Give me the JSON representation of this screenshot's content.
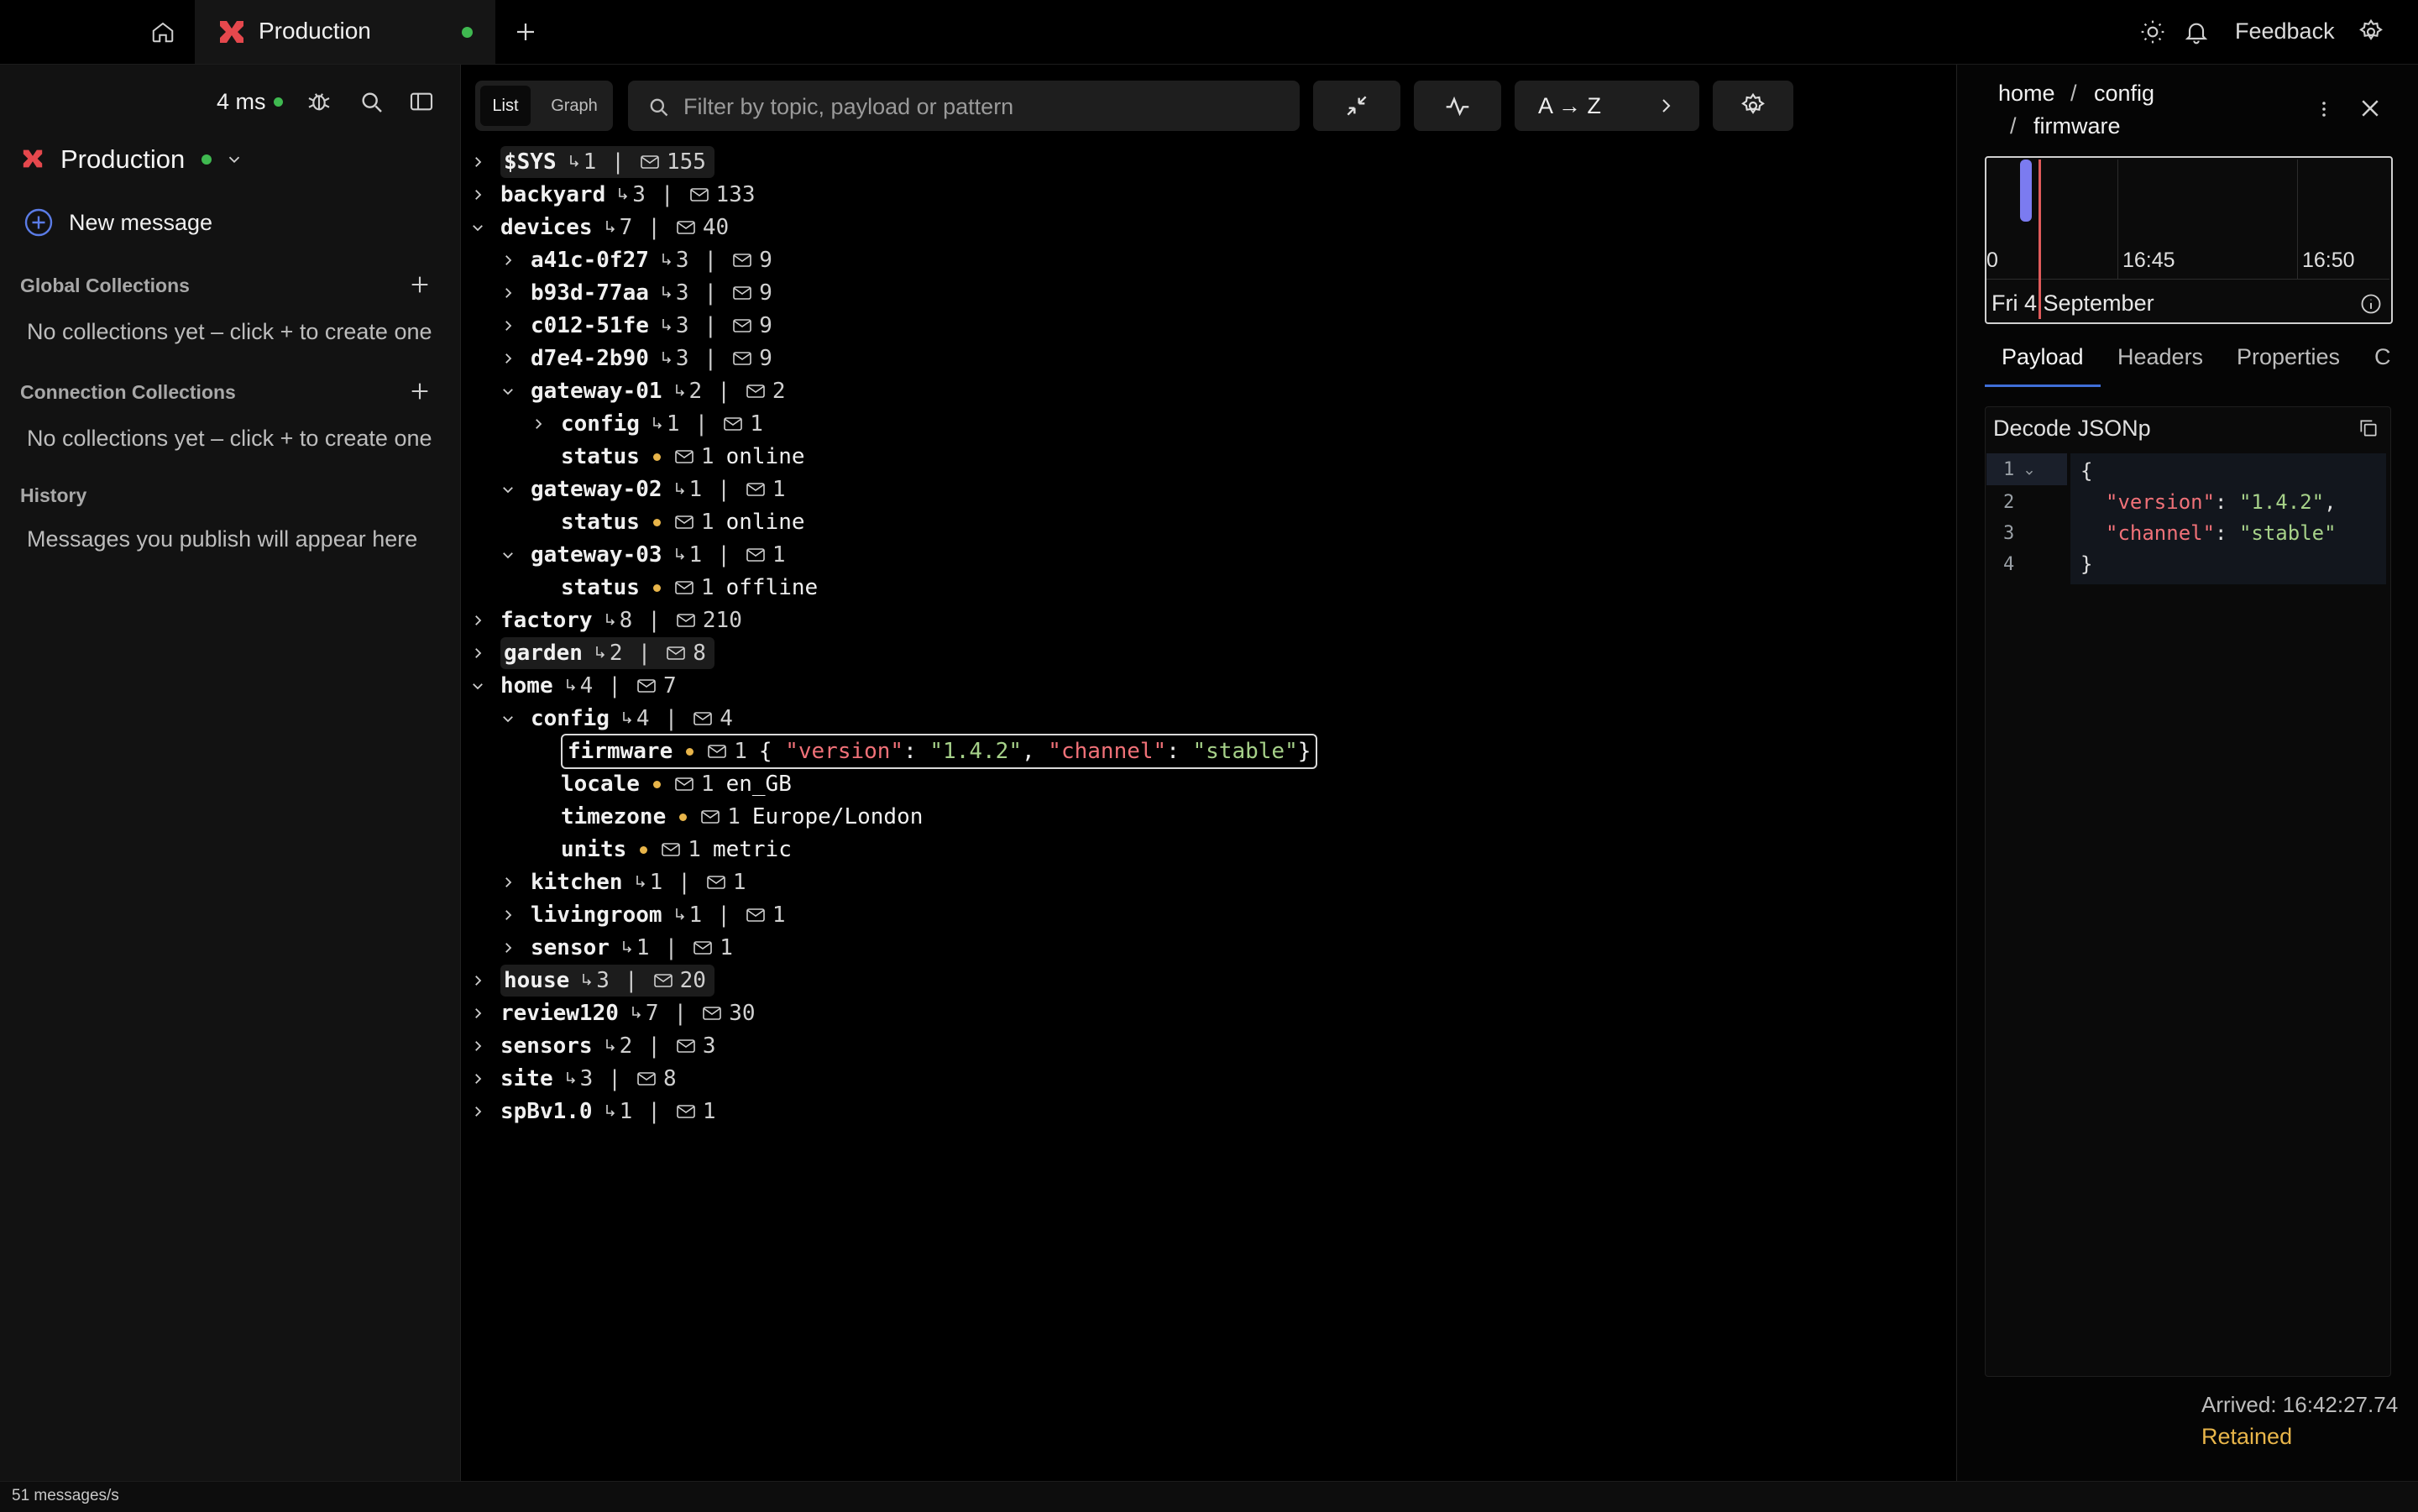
{
  "titlebar": {
    "tab_label": "Production",
    "feedback_label": "Feedback"
  },
  "sidebar": {
    "latency": "4 ms",
    "connection_name": "Production",
    "new_message_label": "New message",
    "global_collections_title": "Global Collections",
    "global_collections_empty": "No collections yet – click + to create one",
    "connection_collections_title": "Connection Collections",
    "connection_collections_empty": "No collections yet – click + to create one",
    "history_title": "History",
    "history_empty": "Messages you publish will appear here"
  },
  "toolbar": {
    "view_list": "List",
    "view_graph": "Graph",
    "filter_placeholder": "Filter by topic, payload or pattern",
    "sort_label": "A → Z"
  },
  "tree": {
    "sys": {
      "name": "$SYS",
      "subtopics": "1",
      "messages": "155"
    },
    "backyard": {
      "name": "backyard",
      "subtopics": "3",
      "messages": "133"
    },
    "devices": {
      "name": "devices",
      "subtopics": "7",
      "messages": "40"
    },
    "a41c": {
      "name": "a41c-0f27",
      "subtopics": "3",
      "messages": "9"
    },
    "b93d": {
      "name": "b93d-77aa",
      "subtopics": "3",
      "messages": "9"
    },
    "c012": {
      "name": "c012-51fe",
      "subtopics": "3",
      "messages": "9"
    },
    "d7e4": {
      "name": "d7e4-2b90",
      "subtopics": "3",
      "messages": "9"
    },
    "gw01": {
      "name": "gateway-01",
      "subtopics": "2",
      "messages": "2"
    },
    "gw01_config": {
      "name": "config",
      "subtopics": "1",
      "messages": "1"
    },
    "gw01_status": {
      "name": "status",
      "messages": "1",
      "value": "online"
    },
    "gw02": {
      "name": "gateway-02",
      "subtopics": "1",
      "messages": "1"
    },
    "gw02_status": {
      "name": "status",
      "messages": "1",
      "value": "online"
    },
    "gw03": {
      "name": "gateway-03",
      "subtopics": "1",
      "messages": "1"
    },
    "gw03_status": {
      "name": "status",
      "messages": "1",
      "value": "offline"
    },
    "factory": {
      "name": "factory",
      "subtopics": "8",
      "messages": "210"
    },
    "garden": {
      "name": "garden",
      "subtopics": "2",
      "messages": "8"
    },
    "home": {
      "name": "home",
      "subtopics": "4",
      "messages": "7"
    },
    "home_config": {
      "name": "config",
      "subtopics": "4",
      "messages": "4"
    },
    "firmware": {
      "name": "firmware",
      "messages": "1",
      "p_open": "{ ",
      "k1": "\"version\"",
      "c1": ": ",
      "v1": "\"1.4.2\"",
      "comma": ", ",
      "k2": "\"channel\"",
      "c2": ": ",
      "v2": "\"stable\"",
      "p_close": "}"
    },
    "locale": {
      "name": "locale",
      "messages": "1",
      "value": "en_GB"
    },
    "timezone": {
      "name": "timezone",
      "messages": "1",
      "value": "Europe/London"
    },
    "units": {
      "name": "units",
      "messages": "1",
      "value": "metric"
    },
    "kitchen": {
      "name": "kitchen",
      "subtopics": "1",
      "messages": "1"
    },
    "livingroom": {
      "name": "livingroom",
      "subtopics": "1",
      "messages": "1"
    },
    "sensor": {
      "name": "sensor",
      "subtopics": "1",
      "messages": "1"
    },
    "house": {
      "name": "house",
      "subtopics": "3",
      "messages": "20"
    },
    "review120": {
      "name": "review120",
      "subtopics": "7",
      "messages": "30"
    },
    "sensors": {
      "name": "sensors",
      "subtopics": "2",
      "messages": "3"
    },
    "site": {
      "name": "site",
      "subtopics": "3",
      "messages": "8"
    },
    "spbv": {
      "name": "spBv1.0",
      "subtopics": "1",
      "messages": "1"
    }
  },
  "details": {
    "breadcrumb": [
      "home",
      "config",
      "firmware"
    ],
    "timeline": {
      "tick_0": "0",
      "tick_1": "16:45",
      "tick_2": "16:50",
      "date": "Fri 4 September"
    },
    "tabs": [
      "Payload",
      "Headers",
      "Properties",
      "C"
    ],
    "decode_label": "Decode",
    "decode_format": "JSONp",
    "code_lines": [
      {
        "n": "1",
        "parts": [
          "{"
        ]
      },
      {
        "n": "2",
        "key": "\"version\"",
        "colon": ": ",
        "val": "\"1.4.2\"",
        "end": ","
      },
      {
        "n": "3",
        "key": "\"channel\"",
        "colon": ": ",
        "val": "\"stable\""
      },
      {
        "n": "4",
        "parts": [
          "}"
        ]
      }
    ],
    "arrived": "Arrived: 16:42:27.74",
    "retained": "Retained"
  },
  "statusbar": {
    "rate": "51 messages/s"
  },
  "colors": {
    "accent_red": "#e5484d",
    "online_green": "#3fb950",
    "retained_yellow": "#e8b54a",
    "json_key": "#f07178",
    "json_string": "#a6d189",
    "selection_blue": "#3f6fd8"
  }
}
